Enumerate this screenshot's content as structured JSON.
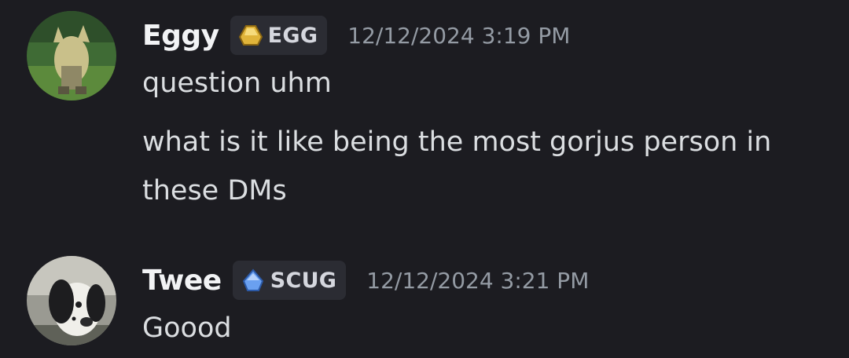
{
  "messages": [
    {
      "username": "Eggy",
      "tag": {
        "label": "EGG",
        "icon": "egg-gem-icon",
        "color": "#e0b43a"
      },
      "timestamp": "12/12/2024 3:19 PM",
      "lines": [
        "question uhm",
        "what is it like being the most gorjus person in",
        "these DMs"
      ]
    },
    {
      "username": "Twee",
      "tag": {
        "label": "SCUG",
        "icon": "scug-gem-icon",
        "color": "#6aa0f0"
      },
      "timestamp": "12/12/2024 3:21 PM",
      "lines": [
        "Goood"
      ]
    }
  ]
}
